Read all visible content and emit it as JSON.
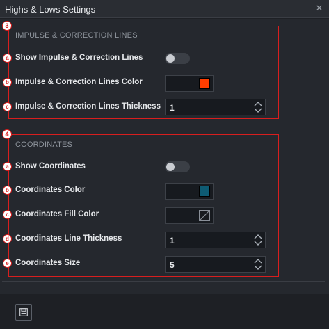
{
  "window": {
    "title": "Highs & Lows Settings",
    "close_glyph": "✕"
  },
  "sections": [
    {
      "number": "3",
      "title": "IMPULSE & CORRECTION LINES",
      "rows": [
        {
          "badge": "a",
          "label": "Show Impulse & Correction Lines",
          "control": "toggle",
          "on": false
        },
        {
          "badge": "b",
          "label": "Impulse & Correction Lines Color",
          "control": "color",
          "color": "#ff3d00"
        },
        {
          "badge": "c",
          "label": "Impulse & Correction Lines Thickness",
          "control": "number",
          "value": "1"
        }
      ]
    },
    {
      "number": "4",
      "title": "COORDINATES",
      "rows": [
        {
          "badge": "a",
          "label": "Show Coordinates",
          "control": "toggle",
          "on": false
        },
        {
          "badge": "b",
          "label": "Coordinates Color",
          "control": "color",
          "color": "#0e5b73"
        },
        {
          "badge": "c",
          "label": "Coordinates Fill Color",
          "control": "color",
          "color": "transparent"
        },
        {
          "badge": "d",
          "label": "Coordinates Line Thickness",
          "control": "number",
          "value": "1"
        },
        {
          "badge": "e",
          "label": "Coordinates Size",
          "control": "number",
          "value": "5"
        }
      ]
    }
  ],
  "footer": {
    "save_icon": "save-icon"
  },
  "colors": {
    "highlight_red": "#d81e1e",
    "background": "#25282e"
  }
}
